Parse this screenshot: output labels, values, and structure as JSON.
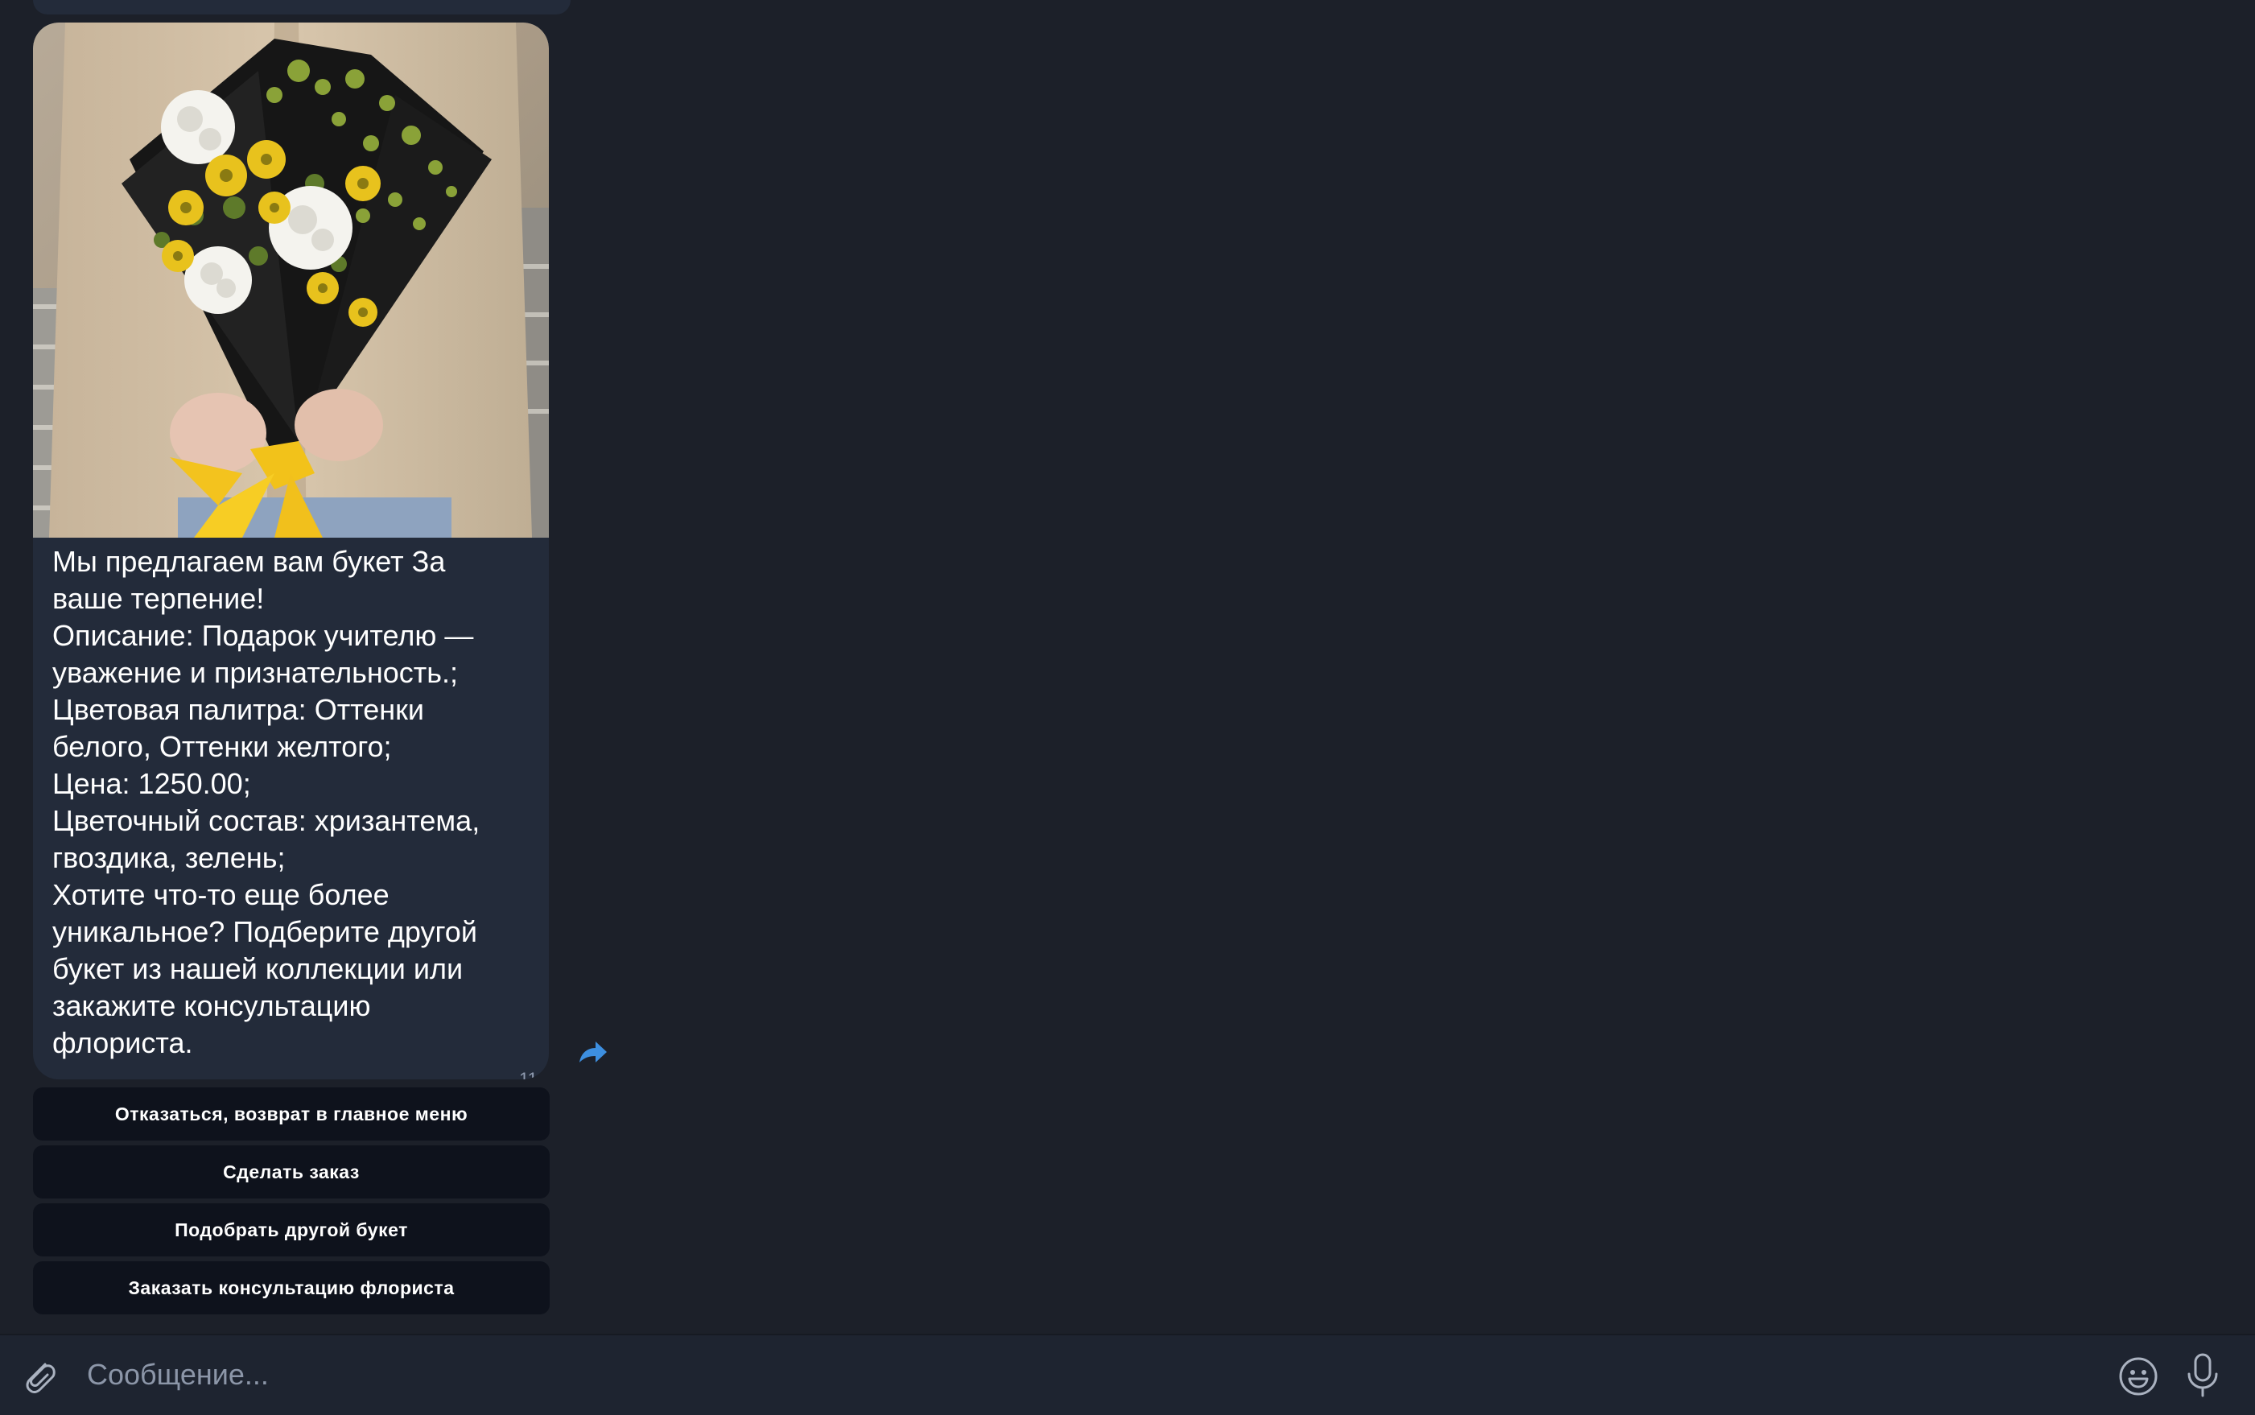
{
  "message": {
    "photo_alt": "bouquet-photo",
    "caption": "Мы предлагаем вам букет За\nваше терпение!\nОписание: Подарок учителю —\nуважение и признательность.;\nЦветовая палитра: Оттенки\nбелого, Оттенки желтого;\nЦена: 1250.00;\nЦветочный состав: хризантема,\nгвоздика, зелень;\nХотите что-то еще более\nуникальное? Подберите другой\nбукет из нашей коллекции или\nзакажите консультацию\nфлориста.",
    "time": "11:33"
  },
  "keyboard": {
    "buttons": [
      "Отказаться, возврат в главное меню",
      "Сделать заказ",
      "Подобрать другой букет",
      "Заказать консультацию флориста"
    ]
  },
  "input": {
    "placeholder": "Сообщение..."
  },
  "icons": {
    "attach": "paperclip-icon",
    "share": "share-icon",
    "emoji": "emoji-icon",
    "mic": "microphone-icon"
  },
  "colors": {
    "background": "#1c2029",
    "bubble": "#232b3a",
    "keyboard_button": "#0e121c",
    "accent": "#3d8fe0"
  }
}
